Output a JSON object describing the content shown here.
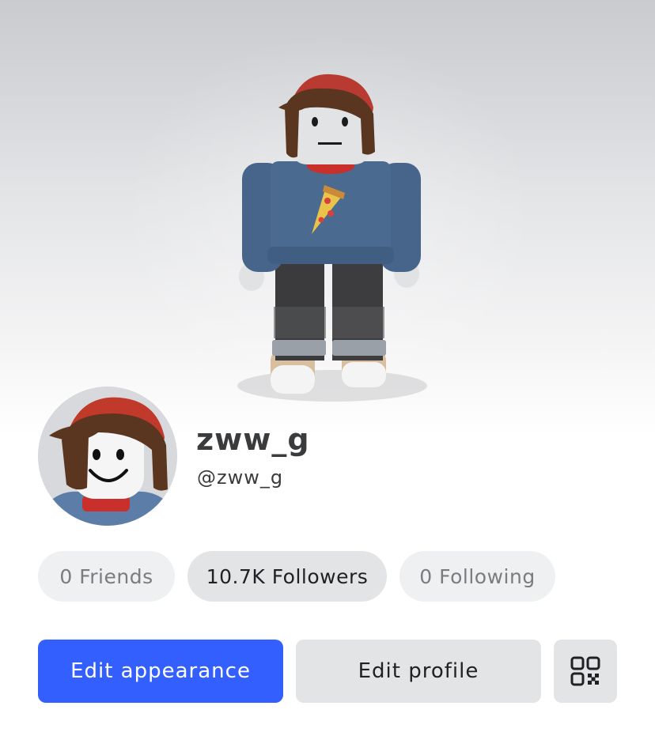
{
  "profile": {
    "display_name": "zww_g",
    "username": "@zww_g"
  },
  "stats": {
    "friends": "0 Friends",
    "followers": "10.7K Followers",
    "following": "0 Following"
  },
  "actions": {
    "edit_appearance": "Edit appearance",
    "edit_profile": "Edit profile",
    "qr_icon": "qr-code-icon"
  },
  "colors": {
    "primary": "#335fff",
    "secondary_bg": "#e3e4e6",
    "pill_bg": "#eff0f1",
    "text_dark": "#393b3d"
  }
}
